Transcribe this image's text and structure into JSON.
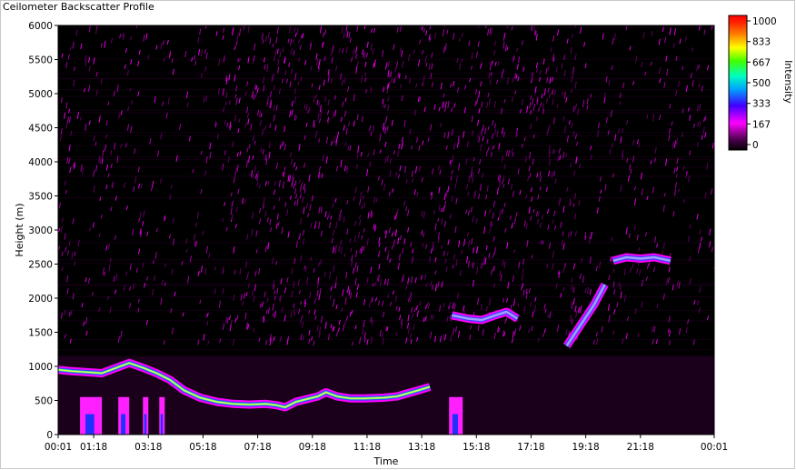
{
  "window": {
    "title": "Ceilometer Backscatter Profile"
  },
  "chart_data": {
    "type": "heatmap",
    "title": "Ceilometer Backscatter Profile",
    "xlabel": "Time",
    "ylabel": "Height (m)",
    "x_ticks": [
      "00:01",
      "01:18",
      "03:18",
      "05:18",
      "07:18",
      "09:18",
      "11:18",
      "13:18",
      "15:18",
      "17:18",
      "19:18",
      "21:18",
      "00:01"
    ],
    "y_ticks": [
      0,
      500,
      1000,
      1500,
      2000,
      2500,
      3000,
      3500,
      4000,
      4500,
      5000,
      5500,
      6000
    ],
    "ylim": [
      0,
      6000
    ],
    "colorbar": {
      "label": "Intensity",
      "ticks": [
        0,
        167,
        333,
        500,
        667,
        833,
        1000
      ],
      "range": [
        0,
        1000
      ]
    },
    "colors": {
      "background": "#000000",
      "noise": "#c000c0",
      "layer_core": "#ffff40"
    },
    "features": [
      {
        "name": "boundary-layer",
        "points": [
          [
            0.0,
            950
          ],
          [
            0.5,
            930
          ],
          [
            1.6,
            900
          ],
          [
            2.6,
            1050
          ],
          [
            3.1,
            980
          ],
          [
            3.6,
            900
          ],
          [
            4.1,
            800
          ],
          [
            4.6,
            650
          ],
          [
            5.2,
            540
          ],
          [
            5.8,
            480
          ],
          [
            6.4,
            450
          ],
          [
            7.0,
            440
          ],
          [
            7.6,
            450
          ],
          [
            8.0,
            430
          ],
          [
            8.3,
            400
          ],
          [
            8.7,
            480
          ],
          [
            9.1,
            520
          ],
          [
            9.5,
            560
          ],
          [
            9.8,
            620
          ],
          [
            10.2,
            560
          ],
          [
            10.7,
            530
          ],
          [
            11.2,
            530
          ],
          [
            11.9,
            540
          ],
          [
            12.4,
            560
          ],
          [
            13.1,
            640
          ],
          [
            13.6,
            700
          ]
        ]
      },
      {
        "name": "upper-layer-a",
        "points": [
          [
            14.4,
            1750
          ],
          [
            15.0,
            1700
          ],
          [
            15.5,
            1680
          ],
          [
            16.0,
            1750
          ],
          [
            16.4,
            1800
          ],
          [
            16.8,
            1700
          ]
        ]
      },
      {
        "name": "upper-layer-b",
        "points": [
          [
            18.6,
            1300
          ],
          [
            19.1,
            1600
          ],
          [
            19.6,
            1900
          ],
          [
            20.0,
            2200
          ]
        ]
      },
      {
        "name": "upper-layer-c",
        "points": [
          [
            20.3,
            2550
          ],
          [
            20.8,
            2600
          ],
          [
            21.3,
            2580
          ],
          [
            21.8,
            2600
          ],
          [
            22.4,
            2550
          ]
        ]
      }
    ],
    "precip_columns": [
      [
        0.8,
        1.6
      ],
      [
        2.2,
        2.6
      ],
      [
        3.1,
        3.3
      ],
      [
        3.7,
        3.9
      ],
      [
        14.3,
        14.8
      ]
    ]
  }
}
